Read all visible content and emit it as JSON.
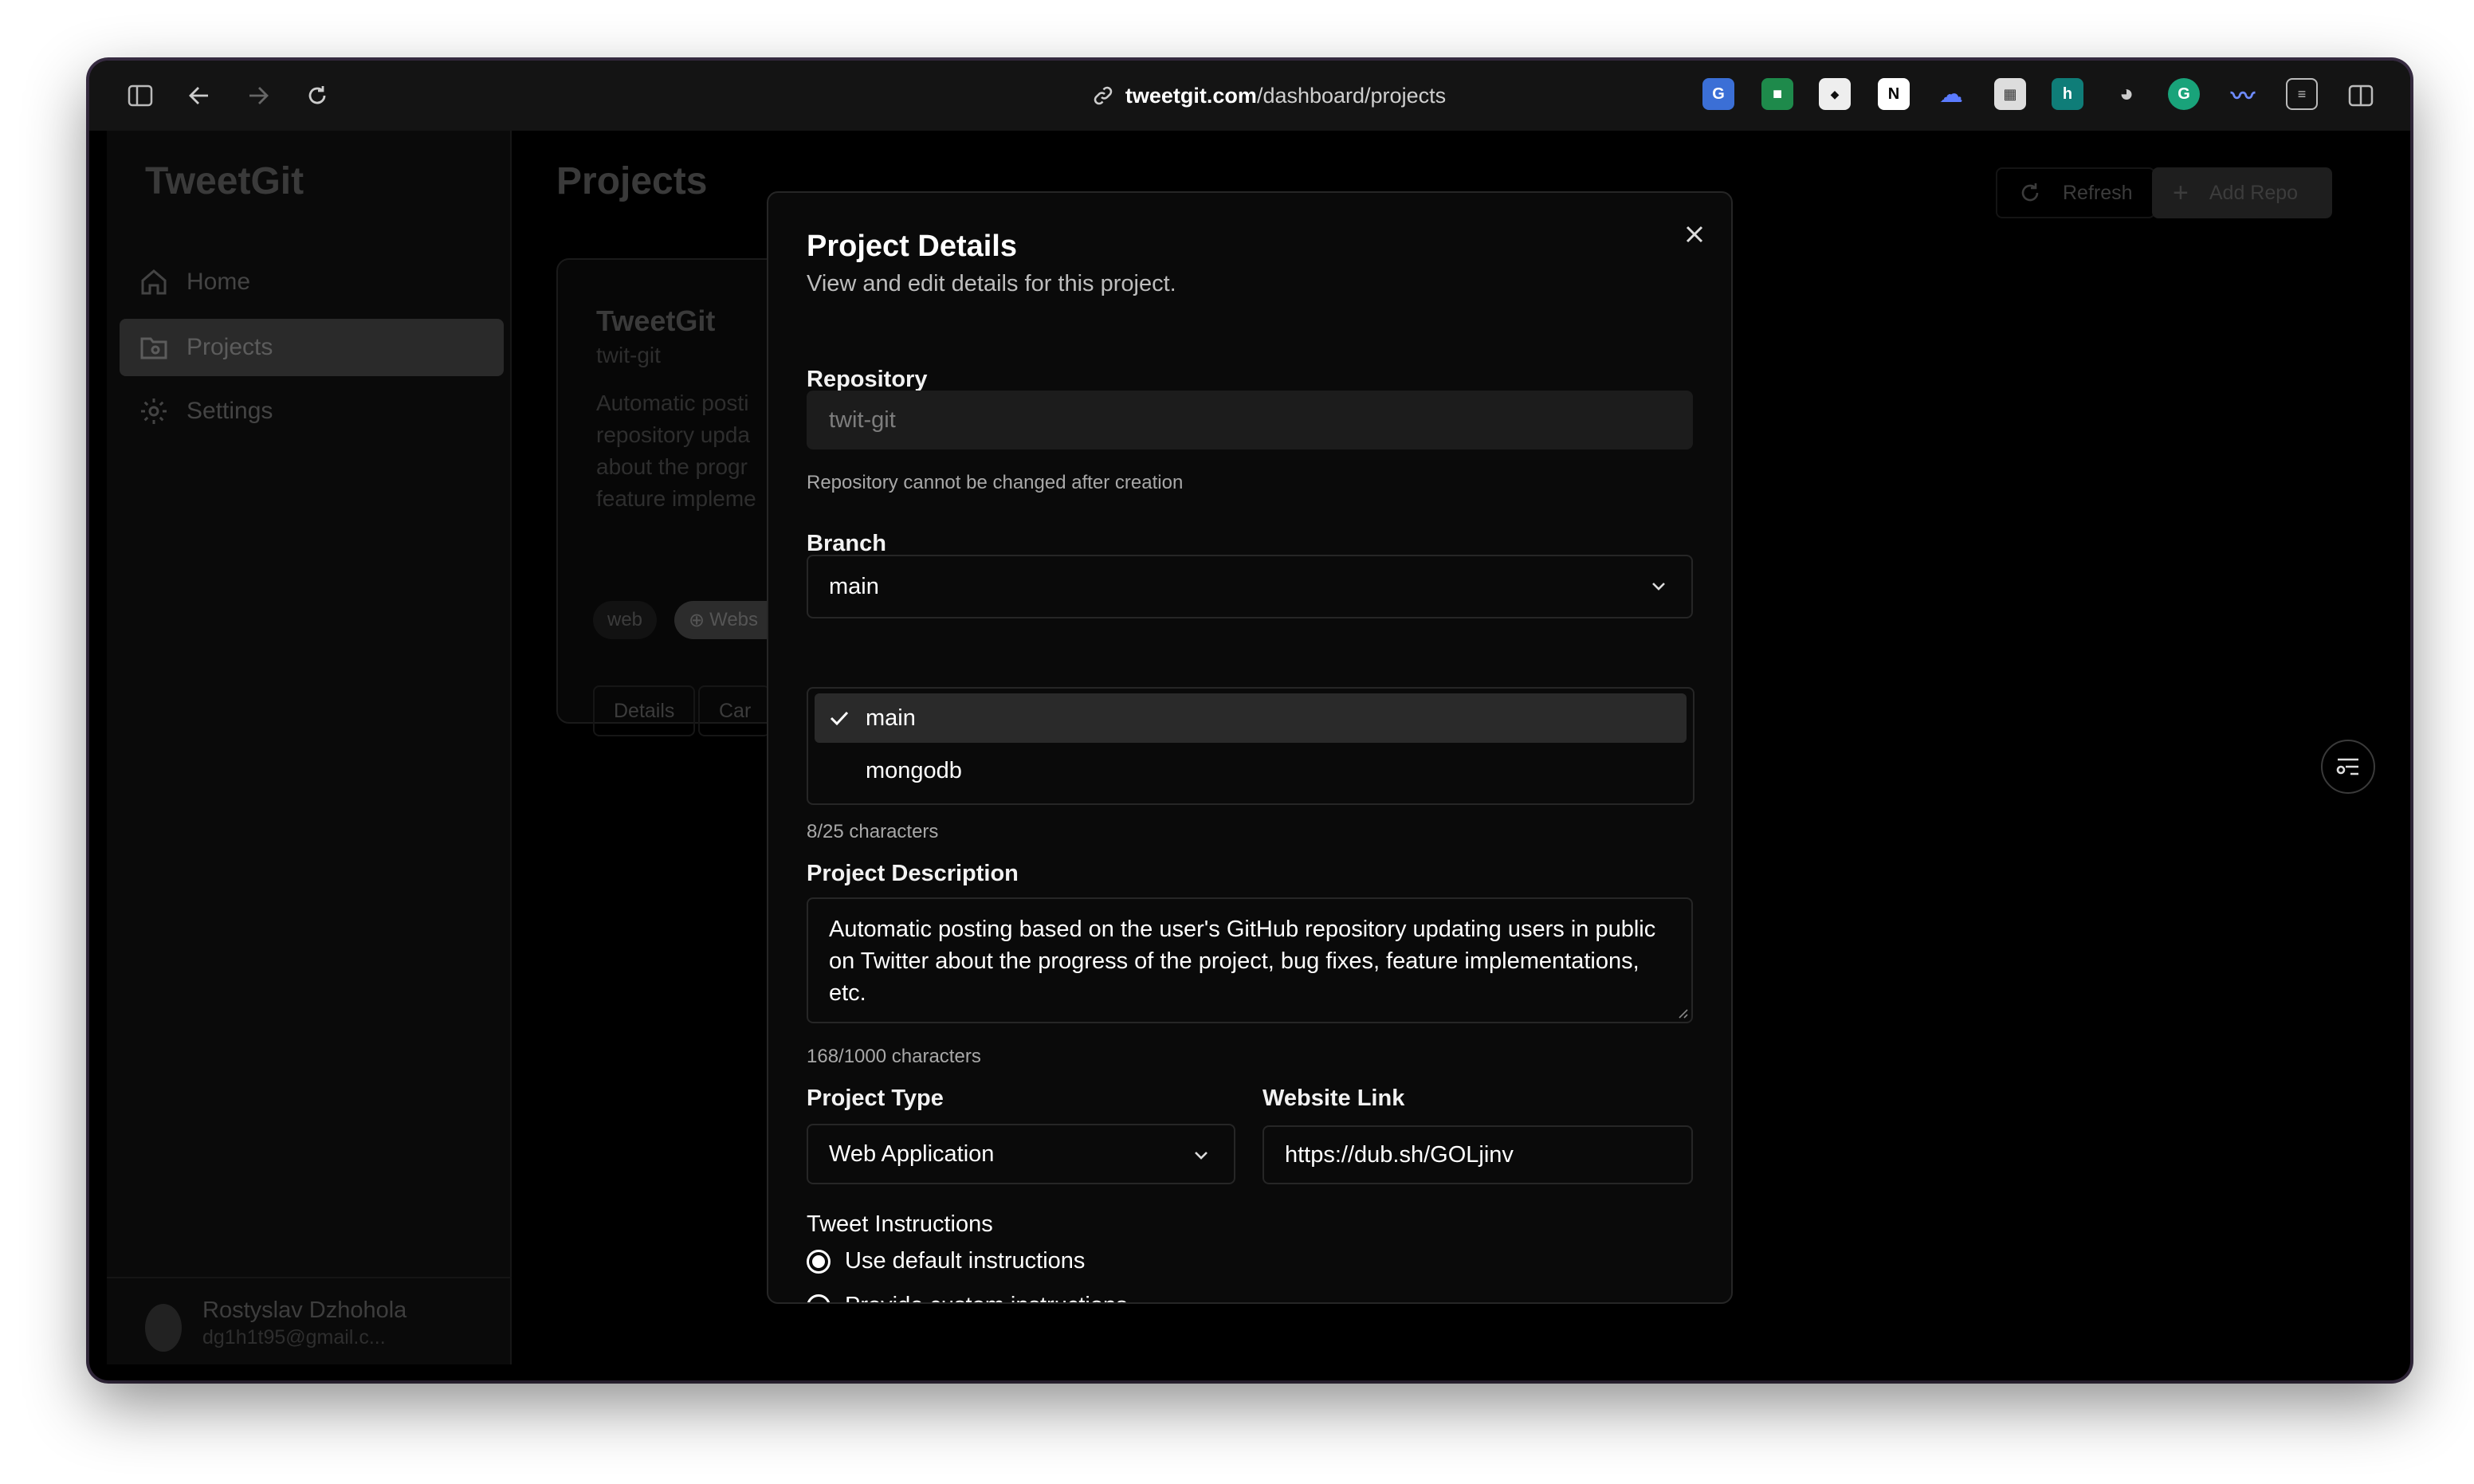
{
  "browser": {
    "url_host": "tweetgit.com",
    "url_path": "/dashboard/projects"
  },
  "sidebar": {
    "brand": "TweetGit",
    "items": [
      {
        "label": "Home",
        "icon": "home-icon"
      },
      {
        "label": "Projects",
        "icon": "projects-icon",
        "active": true
      },
      {
        "label": "Settings",
        "icon": "gear-icon"
      }
    ],
    "user": {
      "name": "Rostyslav Dzhohola",
      "email": "dg1h1t95@gmail.c..."
    }
  },
  "page": {
    "title": "Projects",
    "refresh_label": "Refresh",
    "add_repo_label": "Add Repo"
  },
  "card": {
    "title": "TweetGit",
    "subtitle": "twit-git",
    "desc_lines": [
      "Automatic posti",
      "repository upda",
      "about the progr",
      "feature impleme"
    ],
    "chips": [
      "web",
      "Webs"
    ],
    "buttons": [
      "Details",
      "Car"
    ]
  },
  "modal": {
    "title": "Project Details",
    "subtitle": "View and edit details for this project.",
    "repository": {
      "label": "Repository",
      "value": "twit-git",
      "hint": "Repository cannot be changed after creation"
    },
    "branch": {
      "label": "Branch",
      "value": "main",
      "options": [
        "main",
        "mongodb"
      ],
      "counter": "8/25 characters"
    },
    "description": {
      "label": "Project Description",
      "value": "Automatic posting based on the user's GitHub repository updating users in public on Twitter about the progress of the project, bug fixes, feature implementations, etc.",
      "counter": "168/1000 characters"
    },
    "project_type": {
      "label": "Project Type",
      "value": "Web Application"
    },
    "website": {
      "label": "Website Link",
      "value": "https://dub.sh/GOLjinv"
    },
    "tweet_instructions": {
      "label": "Tweet Instructions",
      "options": [
        "Use default instructions",
        "Provide custom instructions"
      ],
      "selected": 0
    }
  },
  "colors": {
    "background": "#000000",
    "modal_bg": "#0a0a0a",
    "border": "#262626",
    "text": "#ffffff",
    "muted": "#a8a8a8"
  }
}
